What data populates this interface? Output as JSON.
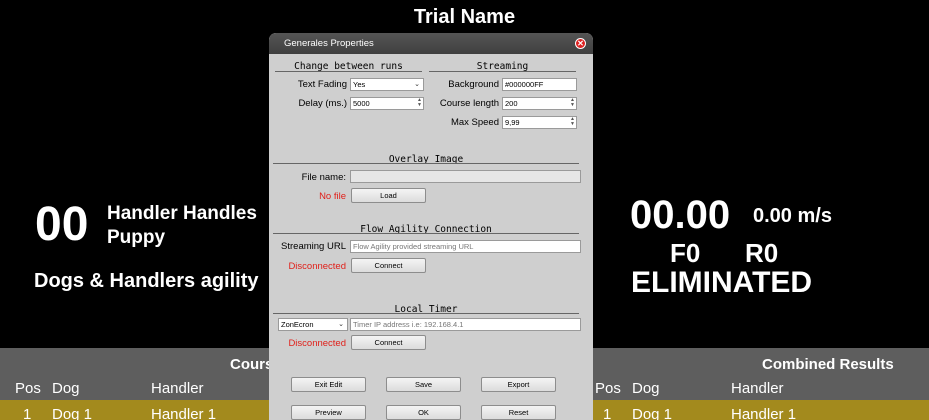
{
  "scoreboard": {
    "trial_name": "Trial Name",
    "dog_number": "00",
    "handler_line1": "Handler Handles",
    "handler_line2": "Puppy",
    "team_name": "Dogs & Handlers agility",
    "time": "00.00",
    "speed": "0.00 m/s",
    "faults": "F0",
    "refusals": "R0",
    "status": "ELIMINATED"
  },
  "results": {
    "course_title": "Cours",
    "combined_title": "Combined Results",
    "columns": [
      "Pos",
      "Dog",
      "Handler"
    ],
    "row1": {
      "pos": "1",
      "dog": "Dog 1",
      "handler": "Handler 1"
    },
    "highlight_color": "#a38a1d"
  },
  "dialog": {
    "title": "Generales Properties",
    "change_between_runs": {
      "title": "Change between runs",
      "text_fading_label": "Text Fading",
      "text_fading_value": "Yes",
      "delay_label": "Delay (ms.)",
      "delay_value": "5000"
    },
    "streaming": {
      "title": "Streaming",
      "background_label": "Background",
      "background_value": "#000000FF",
      "course_length_label": "Course length",
      "course_length_value": "200",
      "max_speed_label": "Max Speed",
      "max_speed_value": "9,99"
    },
    "overlay": {
      "title": "Overlay Image",
      "file_name_label": "File name:",
      "file_name_value": "",
      "status": "No file",
      "load_label": "Load"
    },
    "flow_agility": {
      "title": "Flow Agility Connection",
      "url_label": "Streaming URL",
      "url_placeholder": "Flow Agility provided streaming URL",
      "status": "Disconnected",
      "connect_label": "Connect"
    },
    "local_timer": {
      "title": "Local Timer",
      "timer_type": "ZonEcron",
      "ip_placeholder": "Timer IP address i.e: 192.168.4.1",
      "status": "Disconnected",
      "connect_label": "Connect"
    },
    "buttons": {
      "exit_edit": "Exit Edit",
      "save": "Save",
      "export": "Export",
      "preview": "Preview",
      "ok": "OK",
      "reset": "Reset"
    }
  }
}
